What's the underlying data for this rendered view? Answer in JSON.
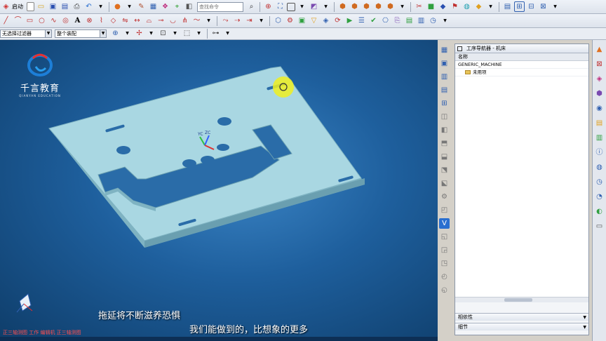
{
  "toolbar": {
    "start_label": "启动",
    "command_search_placeholder": "查找命令",
    "icons_row1": [
      "new-icon",
      "open-icon",
      "save-icon",
      "save-as-icon",
      "print-icon",
      "undo-icon",
      "redo-icon",
      "render-icon",
      "layer-icon",
      "show-hide-icon",
      "snap-icon",
      "view-icon",
      "fit-icon",
      "render-style-icon",
      "shade-icon",
      "zoom-icon",
      "box-icon",
      "cylinder-icon",
      "cone-icon",
      "sphere-icon",
      "extrude-icon",
      "move-icon",
      "color-icon",
      "flag-icon",
      "hole-icon",
      "cam-op-icon",
      "geometry-icon",
      "tool-icon",
      "method-icon",
      "verify-icon",
      "post-icon",
      "clock-icon"
    ],
    "icons_row2": [
      "line-icon",
      "arc-icon",
      "rectangle-icon",
      "circle-icon",
      "spline-icon",
      "text-icon",
      "trim-icon",
      "offset-icon",
      "mirror-icon",
      "pattern-icon",
      "dimension-icon",
      "sketch-icon",
      "extrude-icon",
      "revolve-icon",
      "hole-icon",
      "blend-icon",
      "chamfer-icon",
      "shell-icon",
      "trim-body-icon",
      "operation-icon",
      "program-icon",
      "tool-icon",
      "geometry-icon",
      "method-icon",
      "generate-icon",
      "replay-icon",
      "list-icon",
      "verify-icon",
      "simulate-icon",
      "post-icon",
      "shop-doc-icon",
      "output-icon",
      "info-icon"
    ]
  },
  "filter_bar": {
    "type_filter": "无选择过滤器",
    "assembly_scope": "整个装配"
  },
  "viewport": {
    "logo_text": "千言教育",
    "logo_sub": "QIANYAN EDUCATION",
    "axis_labels": [
      "YC",
      "ZC"
    ],
    "subtitle_line1": "拖延将不断滋养恐惧",
    "subtitle_line2": "我们能做到的，比想象的更多",
    "status_text": "正三轴测图  工作  编辑机  正三轴测图"
  },
  "navigator": {
    "title": "工序导航器 - 机床",
    "column_header": "名称",
    "tree": [
      {
        "label": "GENERIC_MACHINE",
        "level": 0
      },
      {
        "label": "未用项",
        "level": 1
      }
    ],
    "sections": [
      {
        "label": "相依性"
      },
      {
        "label": "细节"
      }
    ]
  },
  "colors": {
    "viewport_blue": "#1e5f9d",
    "part_face": "#a9d7e2",
    "highlight_yellow": "#f0f020"
  }
}
